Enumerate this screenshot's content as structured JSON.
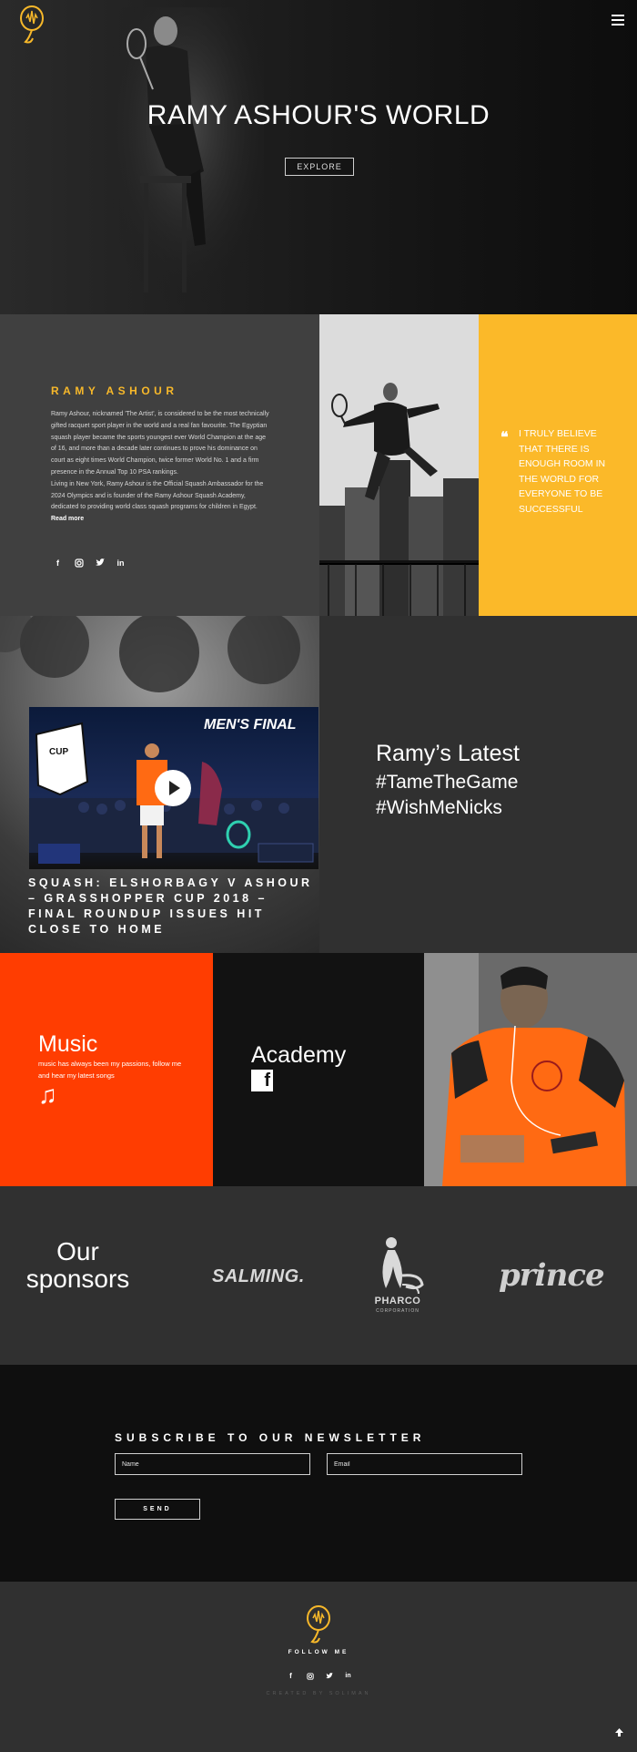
{
  "hero": {
    "title": "RAMY ASHOUR'S WORLD",
    "explore_label": "EXPLORE"
  },
  "about": {
    "name": "RAMY ASHOUR",
    "bio_p1": "Ramy Ashour, nicknamed 'The Artist', is considered to be the most technically gifted racquet sport player in the world and a real fan favourite. The Egyptian squash player became the sports youngest ever World Champion at the age of 16, and more than a decade later continues to prove his dominance on court as eight times World Champion, twice former World No. 1 and a firm presence in the Annual Top 10 PSA rankings.",
    "bio_p2": "Living in New York, Ramy Ashour is the Official Squash Ambassador for the 2024 Olympics and is founder of the Ramy Ashour Squash Academy, dedicated to providing world class squash programs for children in Egypt.",
    "read_more": "Read more",
    "quote": "I TRULY BELIEVE THAT THERE IS ENOUGH ROOM IN THE WORLD FOR EVERYONE TO BE SUCCESSFUL"
  },
  "video": {
    "thumb_heading": "MEN'S FINAL",
    "title": "SQUASH: ELSHORBAGY V ASHOUR – GRASSHOPPER CUP 2018 – FINAL ROUNDUP ISSUES HIT CLOSE TO HOME"
  },
  "latest": {
    "title": "Ramy’s Latest",
    "tag1": "#TameTheGame",
    "tag2": "#WishMeNicks"
  },
  "music": {
    "title": "Music",
    "text": "music has always been my passions, follow me and hear my latest songs"
  },
  "academy": {
    "title": "Academy"
  },
  "sponsors": {
    "title": "Our sponsors",
    "salming": "SALMING.",
    "pharco": "PHARCO",
    "pharco_sub": "CORPORATION",
    "prince": "prince"
  },
  "newsletter": {
    "title": "SUBSCRIBE TO OUR NEWSLETTER",
    "name_placeholder": "Name",
    "email_placeholder": "Email",
    "send_label": "SEND"
  },
  "footer": {
    "follow_me": "FOLLOW ME",
    "created_by": "CREATED BY SOLIMAN"
  },
  "colors": {
    "accent_yellow": "#fbb929",
    "music_orange": "#ff3d01",
    "dark_gray": "#303030"
  }
}
